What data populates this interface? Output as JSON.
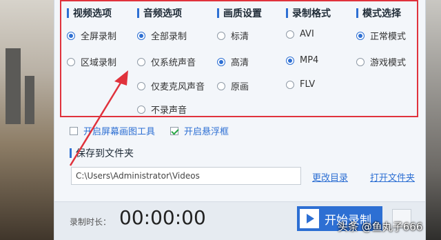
{
  "video": {
    "header": "视频选项",
    "options": [
      {
        "label": "全屏录制",
        "selected": true
      },
      {
        "label": "区域录制",
        "selected": false
      }
    ]
  },
  "audio": {
    "header": "音频选项",
    "options": [
      {
        "label": "全部录制",
        "selected": true
      },
      {
        "label": "仅系统声音",
        "selected": false
      },
      {
        "label": "仅麦克风声音",
        "selected": false
      },
      {
        "label": "不录声音",
        "selected": false
      }
    ]
  },
  "quality": {
    "header": "画质设置",
    "options": [
      {
        "label": "标清",
        "selected": false
      },
      {
        "label": "高清",
        "selected": true
      },
      {
        "label": "原画",
        "selected": false
      }
    ]
  },
  "format": {
    "header": "录制格式",
    "options": [
      {
        "label": "AVI",
        "selected": false
      },
      {
        "label": "MP4",
        "selected": true
      },
      {
        "label": "FLV",
        "selected": false
      }
    ]
  },
  "mode": {
    "header": "模式选择",
    "options": [
      {
        "label": "正常模式",
        "selected": true
      },
      {
        "label": "游戏模式",
        "selected": false
      }
    ]
  },
  "checks": {
    "brush_tool": "开启屏幕画图工具",
    "brush_checked": false,
    "float_window": "开启悬浮框",
    "float_checked": true
  },
  "save": {
    "title": "保存到文件夹",
    "path": "C:\\Users\\Administrator\\Videos",
    "change_dir": "更改目录",
    "open_folder": "打开文件夹"
  },
  "footer": {
    "duration_label": "录制时长：",
    "duration_value": "00:00:00",
    "start_label": "开始录制"
  },
  "watermark": "头条 @鱼丸子666",
  "colors": {
    "accent": "#2d6fd3",
    "highlight": "#e0323c",
    "check": "#28a745"
  }
}
